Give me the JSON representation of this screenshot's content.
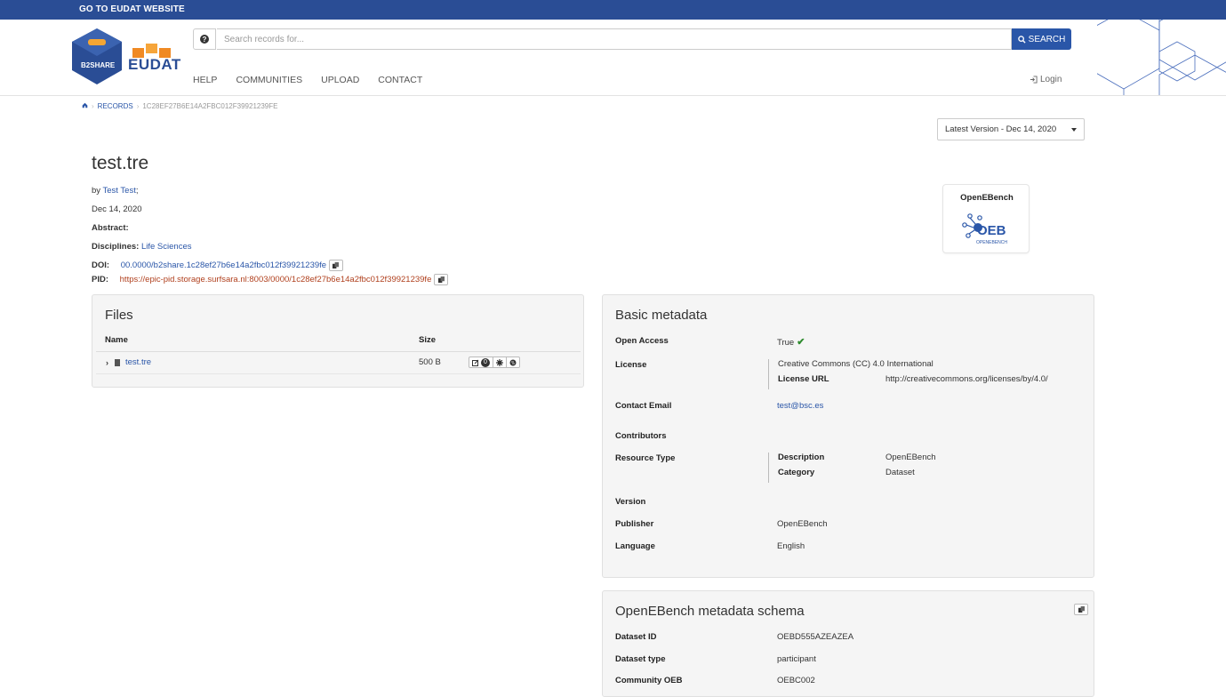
{
  "topbar": {
    "link": "GO TO EUDAT WEBSITE"
  },
  "logo": {
    "b2share": "B2SHARE",
    "eudat": "EUDAT"
  },
  "search": {
    "help": "?",
    "placeholder": "Search records for...",
    "button": "SEARCH"
  },
  "nav": {
    "items": [
      "HELP",
      "COMMUNITIES",
      "UPLOAD",
      "CONTACT"
    ],
    "login": "Login"
  },
  "breadcrumb": {
    "records": "RECORDS",
    "current": "1C28EF27B6E14A2FBC012F39921239FE"
  },
  "version_select": "Latest Version - Dec 14, 2020",
  "record": {
    "title": "test.tre",
    "by_label": "by",
    "author": "Test Test",
    "author_suffix": ";",
    "date": "Dec 14, 2020",
    "abstract_label": "Abstract:",
    "disciplines_label": "Disciplines:",
    "discipline": "Life Sciences",
    "doi_label": "DOI:",
    "doi": "00.0000/b2share.1c28ef27b6e14a2fbc012f39921239fe",
    "pid_label": "PID:",
    "pid": "https://epic-pid.storage.surfsara.nl:8003/0000/1c28ef27b6e14a2fbc012f39921239fe"
  },
  "community": {
    "name": "OpenEBench",
    "logo_text": "OPENEBENCH"
  },
  "files": {
    "title": "Files",
    "col_name": "Name",
    "col_size": "Size",
    "rows": [
      {
        "name": "test.tre",
        "size": "500 B",
        "count": "0"
      }
    ]
  },
  "basic": {
    "title": "Basic metadata",
    "open_access_label": "Open Access",
    "open_access": "True",
    "license_label": "License",
    "license": "Creative Commons (CC) 4.0 International",
    "license_url_label": "License URL",
    "license_url": "http://creativecommons.org/licenses/by/4.0/",
    "contact_label": "Contact Email",
    "contact": "test@bsc.es",
    "contributors_label": "Contributors",
    "resource_type_label": "Resource Type",
    "description_label": "Description",
    "description": "OpenEBench",
    "category_label": "Category",
    "category": "Dataset",
    "version_label": "Version",
    "publisher_label": "Publisher",
    "publisher": "OpenEBench",
    "language_label": "Language",
    "language": "English"
  },
  "oeb": {
    "title": "OpenEBench metadata schema",
    "dataset_id_label": "Dataset ID",
    "dataset_id": "OEBD555AZEAZEA",
    "dataset_type_label": "Dataset type",
    "dataset_type": "participant",
    "community_label": "Community OEB",
    "community": "OEBC002"
  },
  "colors": {
    "brand": "#2a4d95",
    "link": "#2a56a8",
    "pid": "#b0401e",
    "check": "#2e8b2e"
  }
}
